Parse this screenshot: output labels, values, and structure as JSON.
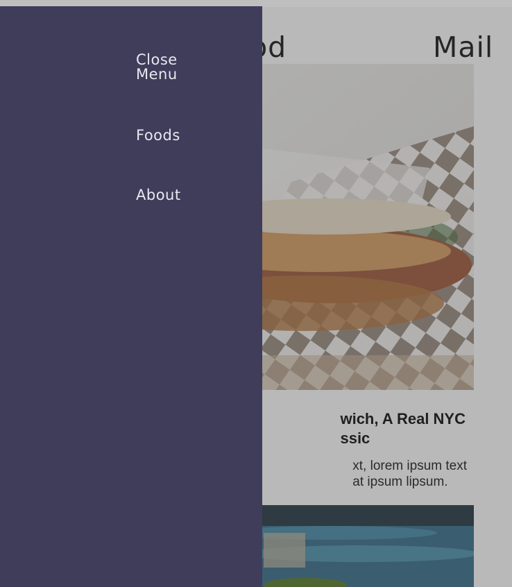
{
  "header": {
    "title_part_left": "ood",
    "title_part_right": "Mail"
  },
  "menu": {
    "close_label": "Close\nMenu",
    "items": [
      {
        "label": "Foods"
      },
      {
        "label": "About"
      }
    ]
  },
  "cards": [
    {
      "image_alt": "sandwich on checkered paper",
      "title": "wich, A Real NYC\nssic",
      "text": "xt, lorem ipsum text\nat ipsum lipsum."
    },
    {
      "image_alt": "food photo by water"
    }
  ],
  "colors": {
    "drawer": "#3f3d5a",
    "menu_text": "#e9e8f0",
    "overlay": "rgba(60,60,60,0.33)"
  }
}
